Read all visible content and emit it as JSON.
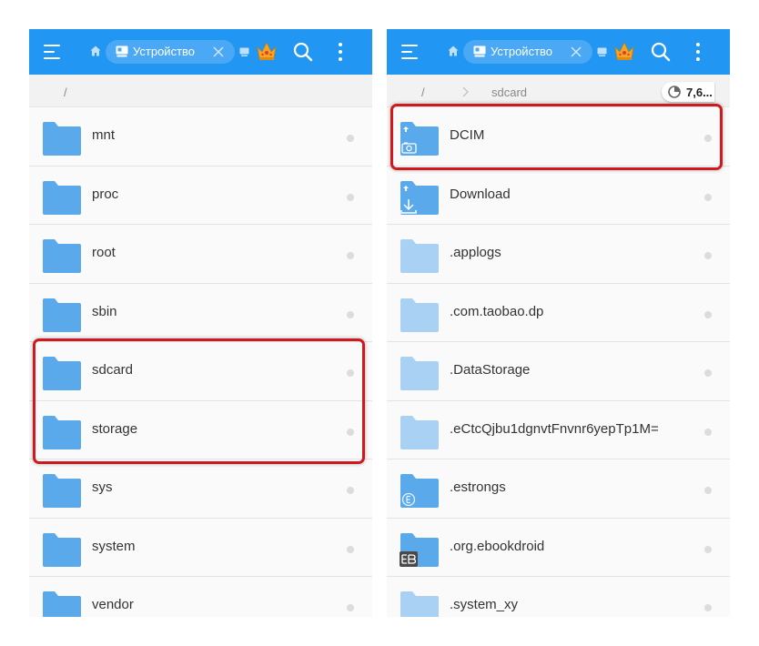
{
  "colors": {
    "toolbar": "#2196f3",
    "tab_bg": "#4aa8f5",
    "folder": "#5aa9ea",
    "folder_light": "#a9d1f3",
    "highlight": "#d0191c",
    "crown": "#f5a623"
  },
  "icons": {
    "menu": "hamburger-icon",
    "home": "home-icon",
    "tab": "window-icon",
    "tab_close": "close-icon",
    "crown": "crown-icon",
    "search": "search-icon",
    "more": "more-vert-icon",
    "storage": "pie-chart-icon"
  },
  "left": {
    "toolbar": {
      "tab_label": "Устройство"
    },
    "breadcrumb": {
      "root": "/"
    },
    "items": [
      {
        "label": "mnt",
        "style": "normal",
        "highlight": false
      },
      {
        "label": "proc",
        "style": "normal",
        "highlight": false
      },
      {
        "label": "root",
        "style": "normal",
        "highlight": false
      },
      {
        "label": "sbin",
        "style": "normal",
        "highlight": false
      },
      {
        "label": "sdcard",
        "style": "normal",
        "highlight": true
      },
      {
        "label": "storage",
        "style": "normal",
        "highlight": true
      },
      {
        "label": "sys",
        "style": "normal",
        "highlight": false
      },
      {
        "label": "system",
        "style": "normal",
        "highlight": false
      },
      {
        "label": "vendor",
        "style": "normal",
        "highlight": false
      }
    ]
  },
  "right": {
    "toolbar": {
      "tab_label": "Устройство"
    },
    "breadcrumb": {
      "root": "/",
      "current": "sdcard",
      "storage_badge": "7,6..."
    },
    "items": [
      {
        "label": "DCIM",
        "style": "camera",
        "highlight": true
      },
      {
        "label": "Download",
        "style": "download",
        "highlight": false
      },
      {
        "label": ".applogs",
        "style": "light",
        "highlight": false
      },
      {
        "label": ".com.taobao.dp",
        "style": "light",
        "highlight": false
      },
      {
        "label": ".DataStorage",
        "style": "light",
        "highlight": false
      },
      {
        "label": ".eCtcQjbu1dgnvtFnvnr6yepTp1M=",
        "style": "light",
        "highlight": false
      },
      {
        "label": ".estrongs",
        "style": "es",
        "highlight": false
      },
      {
        "label": ".org.ebookdroid",
        "style": "eb",
        "highlight": false
      },
      {
        "label": ".system_xy",
        "style": "light",
        "highlight": false
      }
    ]
  }
}
